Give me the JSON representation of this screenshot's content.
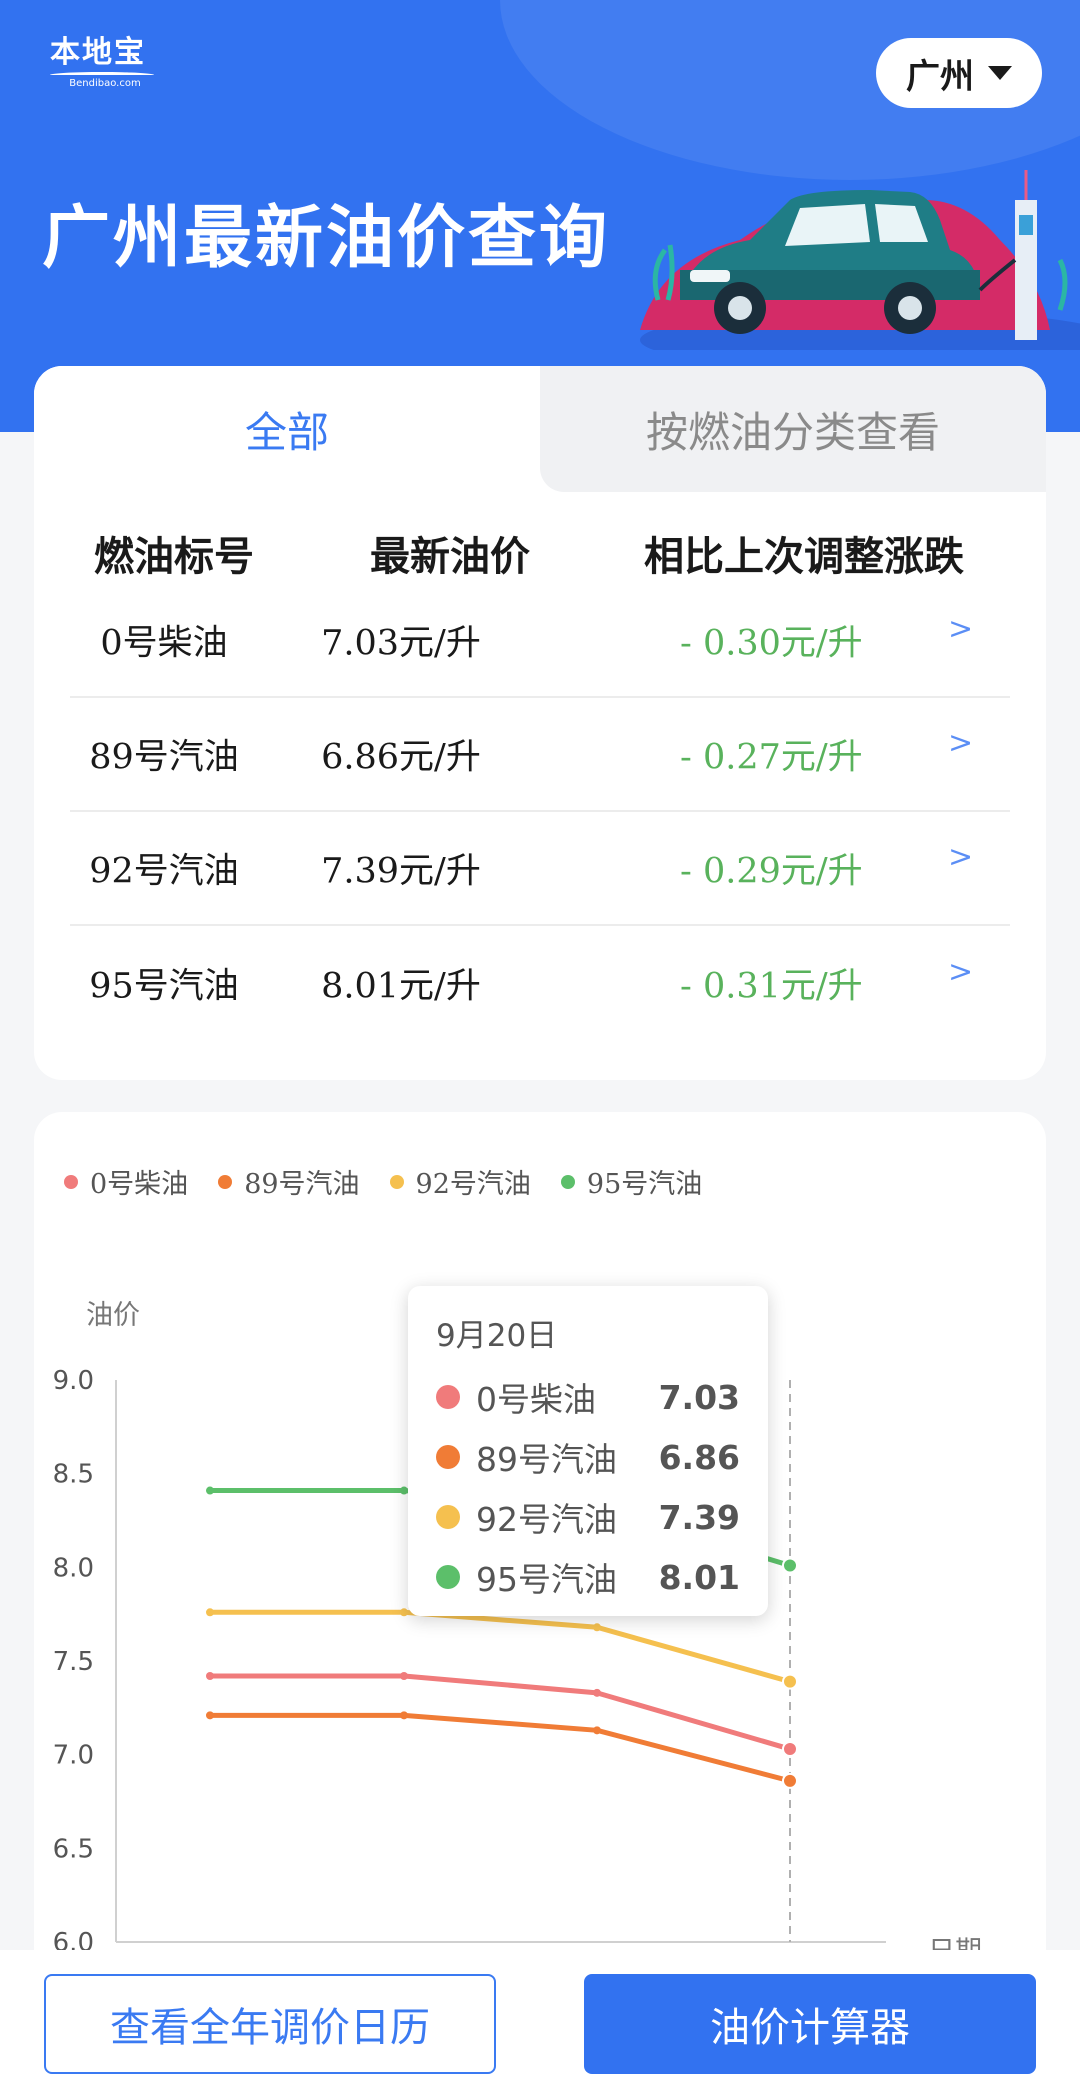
{
  "header": {
    "logo_text": "本地宝",
    "logo_sub": "Bendibao.com",
    "city": "广州",
    "title": "广州最新油价查询"
  },
  "tabs": [
    {
      "label": "全部",
      "active": true
    },
    {
      "label": "按燃油分类查看",
      "active": false
    }
  ],
  "table": {
    "columns": [
      "燃油标号",
      "最新油价",
      "相比上次调整涨跌"
    ],
    "rows": [
      {
        "name": "0号柴油",
        "price": "7.03元/升",
        "change": "- 0.30元/升",
        "arrow": ">"
      },
      {
        "name": "89号汽油",
        "price": "6.86元/升",
        "change": "- 0.27元/升",
        "arrow": ">"
      },
      {
        "name": "92号汽油",
        "price": "7.39元/升",
        "change": "- 0.29元/升",
        "arrow": ">"
      },
      {
        "name": "95号汽油",
        "price": "8.01元/升",
        "change": "- 0.31元/升",
        "arrow": ">"
      }
    ]
  },
  "chart_data": {
    "type": "line",
    "ylabel": "油价",
    "xlabel": "日期",
    "ylim": [
      6.0,
      9.0
    ],
    "yticks": [
      "9.0",
      "8.5",
      "8.0",
      "7.5",
      "7.0",
      "6.5",
      "6.0"
    ],
    "x": [
      0,
      1,
      2,
      3
    ],
    "series": [
      {
        "name": "0号柴油",
        "color": "#f07b7b",
        "values": [
          7.42,
          7.42,
          7.33,
          7.03
        ]
      },
      {
        "name": "89号汽油",
        "color": "#f07c36",
        "values": [
          7.21,
          7.21,
          7.13,
          6.86
        ]
      },
      {
        "name": "92号汽油",
        "color": "#f5c04f",
        "values": [
          7.76,
          7.76,
          7.68,
          7.39
        ]
      },
      {
        "name": "95号汽油",
        "color": "#5cbf6a",
        "values": [
          8.41,
          8.41,
          8.32,
          8.01
        ]
      }
    ],
    "tooltip": {
      "date": "9月20日",
      "items": [
        {
          "name": "0号柴油",
          "value": "7.03",
          "color": "#f07b7b"
        },
        {
          "name": "89号汽油",
          "value": "6.86",
          "color": "#f07c36"
        },
        {
          "name": "92号汽油",
          "value": "7.39",
          "color": "#f5c04f"
        },
        {
          "name": "95号汽油",
          "value": "8.01",
          "color": "#5cbf6a"
        }
      ]
    }
  },
  "buttons": {
    "calendar": "查看全年调价日历",
    "calculator": "油价计算器"
  },
  "colors": {
    "brand": "#3272f0",
    "accent_text": "#3a7af2",
    "decrease": "#59b25c"
  }
}
